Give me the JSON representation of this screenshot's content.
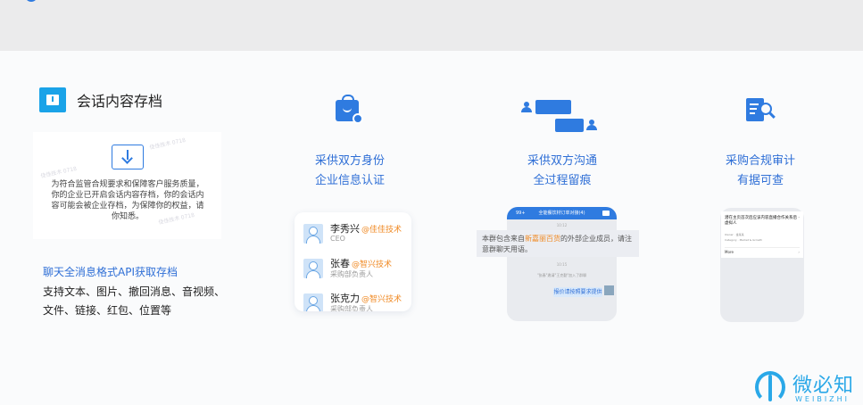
{
  "feature": {
    "title": "会话内容存档",
    "notice_text": "为符合监管合规要求和保障客户服务质量，你的企业已开启会话内容存档，你的会话内容可能会被企业存档，为保障你的权益，请你知悉。",
    "watermark": "佳佳技术 0718",
    "api_title": "聊天全消息格式API获取存档",
    "api_desc": "支持文本、图片、撤回消息、音视频、文件、链接、红包、位置等"
  },
  "columns": [
    {
      "line1": "采供双方身份",
      "line2": "企业信息认证"
    },
    {
      "line1": "采供双方沟通",
      "line2": "全过程留痕"
    },
    {
      "line1": "采购合规审计",
      "line2": "有据可查"
    }
  ],
  "contacts": [
    {
      "name": "李秀兴",
      "corp": "@佳佳技术",
      "role": "CEO"
    },
    {
      "name": "张春",
      "corp": "@智兴技术",
      "role": "采购部负责人"
    },
    {
      "name": "张克力",
      "corp": "@智兴技术",
      "role": "采购部负责人"
    }
  ],
  "chat": {
    "header": "全能餐饮材订单对接(4)",
    "back": "99+",
    "banner_prefix": "本群包含来自",
    "banner_highlight": "新嘉丽百货",
    "banner_suffix": "的外部企业成员，请注意群聊天用语。",
    "time1": "10:12",
    "time2": "10:15",
    "system_msg": "\"张春\"邀请\"王克勤\"加入了群聊",
    "message": "报价请按照要求提供"
  },
  "audit": {
    "title": "潜在主页首次后应该内容直播合作关系后  · 虚拟人",
    "line1": "Owner · 金某某",
    "line2": "Category · Market & Growth",
    "more": "More",
    "arrow": "›"
  },
  "brand": {
    "name": "微必知",
    "sub": "WEIBIZHI"
  },
  "colors": {
    "accent": "#2f7be0",
    "link": "#2f6fd6",
    "highlight": "#f08a24",
    "brand": "#2aa8e8"
  }
}
